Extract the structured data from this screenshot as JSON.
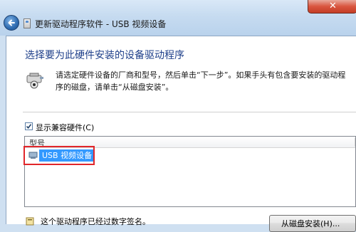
{
  "window": {
    "title": "更新驱动程序软件 - USB 视频设备",
    "close_glyph": "✕"
  },
  "main": {
    "heading": "选择要为此硬件安装的设备驱动程序",
    "instruction": "请选定硬件设备的厂商和型号，然后单击“下一步”。如果手头有包含要安装的驱动程序的磁盘，请单击“从磁盘安装”。",
    "compatible_checkbox": {
      "label": "显示兼容硬件(C)",
      "checked": true
    },
    "model_list": {
      "column_header": "型号",
      "items": [
        {
          "label": "USB 视频设备",
          "selected": true,
          "icon": "webcam-device-icon"
        }
      ]
    },
    "signature_note": "这个驱动程序已经过数字签名。",
    "have_disk_button": "从磁盘安装(H)..."
  },
  "colors": {
    "heading": "#1e3f8a",
    "selection": "#3399ff",
    "highlight_box": "#e1262a"
  }
}
